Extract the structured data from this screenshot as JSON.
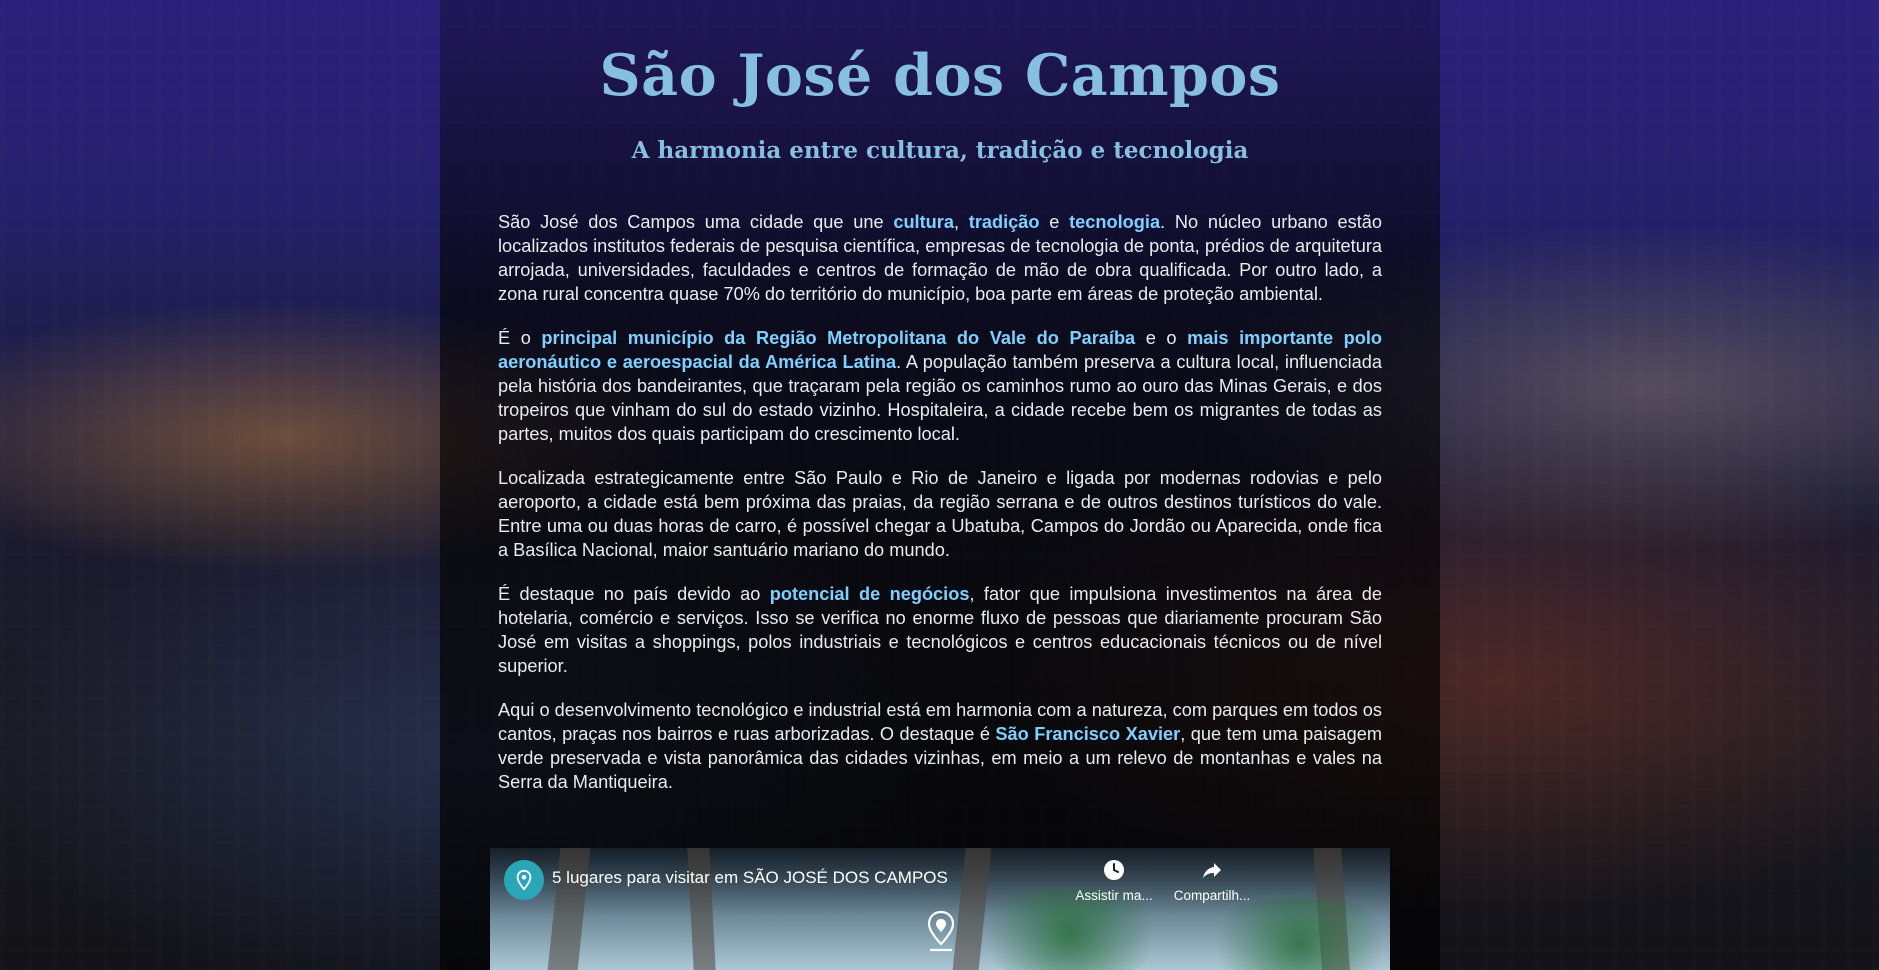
{
  "page": {
    "title": "São José dos Campos",
    "subtitle": "A harmonia entre cultura, tradição e tecnologia"
  },
  "paragraphs": [
    {
      "p1_a": "São José dos Campos uma cidade que une ",
      "p1_h1": "cultura",
      "p1_b": ", ",
      "p1_h2": "tradição",
      "p1_c": " e ",
      "p1_h3": "tecnologia",
      "p1_d": ". No núcleo urbano estão localizados institutos federais de pesquisa científica, empresas de tecnologia de ponta, prédios de arquitetura arrojada, universidades, faculdades e centros de formação de mão de obra qualificada. Por outro lado, a zona rural concentra quase 70% do território do município, boa parte em áreas de proteção ambiental."
    },
    {
      "p2_a": "É o ",
      "p2_h1": "principal município da Região Metropolitana do Vale do Paraíba",
      "p2_b": " e o ",
      "p2_h2": "mais importante polo aeronáutico e aeroespacial da América Latina",
      "p2_c": ". A população também preserva a cultura local, influenciada pela história dos bandeirantes, que traçaram pela região os caminhos rumo ao ouro das Minas Gerais, e dos tropeiros que vinham do sul do estado vizinho. Hospitaleira, a cidade recebe bem os migrantes de todas as partes, muitos dos quais participam do crescimento local."
    },
    {
      "p3": "Localizada estrategicamente entre São Paulo e Rio de Janeiro e ligada por modernas rodovias e pelo aeroporto, a cidade está bem próxima das praias, da região serrana e de outros destinos turísticos do vale. Entre uma ou duas horas de carro, é possível chegar a Ubatuba, Campos do Jordão ou Aparecida, onde fica a Basílica Nacional, maior santuário mariano do mundo."
    },
    {
      "p4_a": "É destaque no país devido ao ",
      "p4_h1": "potencial de negócios",
      "p4_b": ", fator que impulsiona investimentos na área de hotelaria, comércio e serviços. Isso se verifica no enorme fluxo de pessoas que diariamente procuram São José em visitas a shoppings, polos industriais e tecnológicos e centros educacionais técnicos ou de nível superior."
    },
    {
      "p5_a": "Aqui o desenvolvimento tecnológico e industrial está em harmonia com a natureza, com parques em todos os cantos, praças nos bairros e ruas arborizadas. O destaque é ",
      "p5_h1": "São Francisco Xavier",
      "p5_b": ", que tem uma paisagem verde preservada e vista panorâmica das cidades vizinhas, em meio a um relevo de montanhas e vales na Serra da Mantiqueira."
    }
  ],
  "video": {
    "title": "5 lugares para visitar em SÃO JOSÉ DOS CAMPOS",
    "watch_later_label": "Assistir ma...",
    "share_label": "Compartilh...",
    "channel_icon": "map-pin-icon",
    "watch_later_icon": "clock-icon",
    "share_icon": "share-arrow-icon",
    "center_icon": "map-pin-download-icon"
  },
  "colors": {
    "heading": "#86bfe0",
    "highlight": "#7fd0ff",
    "body_text": "#e9ecef",
    "channel_badge": "#2aa6b8"
  }
}
